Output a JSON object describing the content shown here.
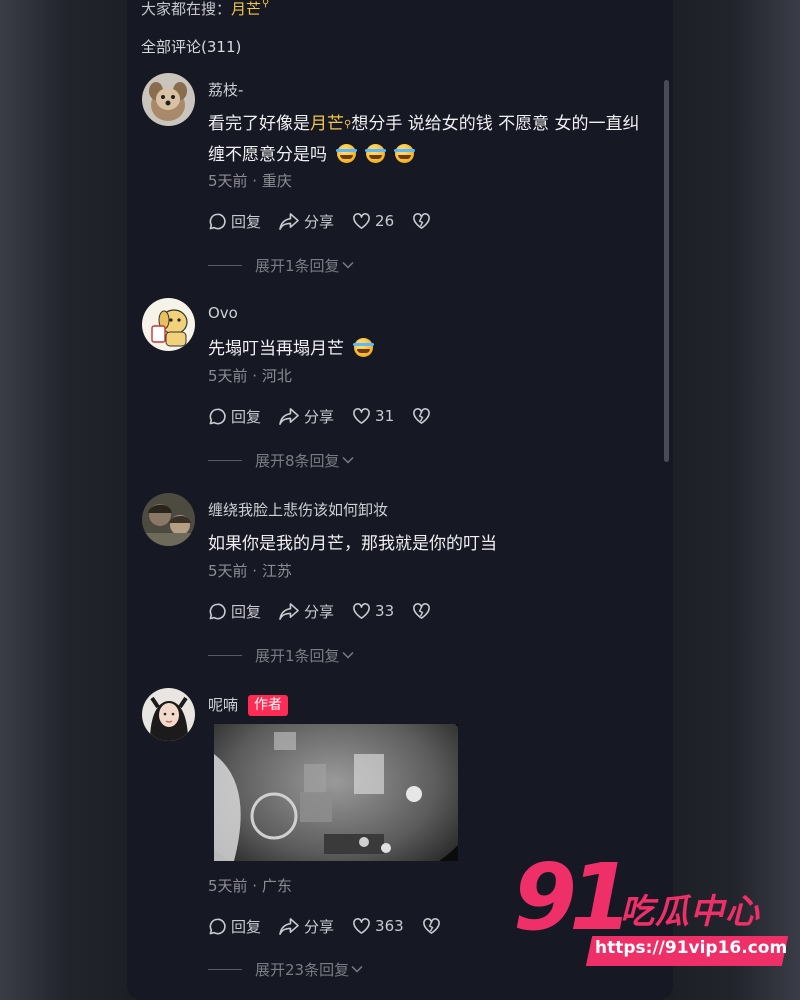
{
  "header": {
    "search_prefix": "大家都在搜：",
    "search_keyword": "月芒",
    "comment_count": "全部评论(311)"
  },
  "actions_labels": {
    "reply": "回复",
    "share": "分享"
  },
  "comments": [
    {
      "username": "荔枝-",
      "text_before": "看完了好像是",
      "keyword": "月芒",
      "text_after": "想分手 说给女的钱 不愿意 女的一直纠缠不愿意分是吗",
      "emoji_count": 3,
      "meta": "5天前 · 重庆",
      "likes": "26",
      "expand": "展开1条回复"
    },
    {
      "username": "Ovo",
      "text": "先塌叮当再塌月芒",
      "emoji_count": 1,
      "meta": "5天前 · 河北",
      "likes": "31",
      "expand": "展开8条回复"
    },
    {
      "username": "缠绕我脸上悲伤该如何卸妆",
      "text": "如果你是我的月芒，那我就是你的叮当",
      "emoji_count": 0,
      "meta": "5天前 · 江苏",
      "likes": "33",
      "expand": "展开1条回复"
    },
    {
      "username": "呢喃",
      "badge": "作者",
      "meta": "5天前 · 广东",
      "likes": "363",
      "expand": "展开23条回复"
    }
  ],
  "watermark": {
    "number": "91",
    "title": "吃瓜中心",
    "url": "https://91vip16.com"
  },
  "colors": {
    "background": "#161823",
    "keyword": "#f2c744",
    "author_badge": "#fe2c55",
    "watermark": "#ef2f67"
  }
}
